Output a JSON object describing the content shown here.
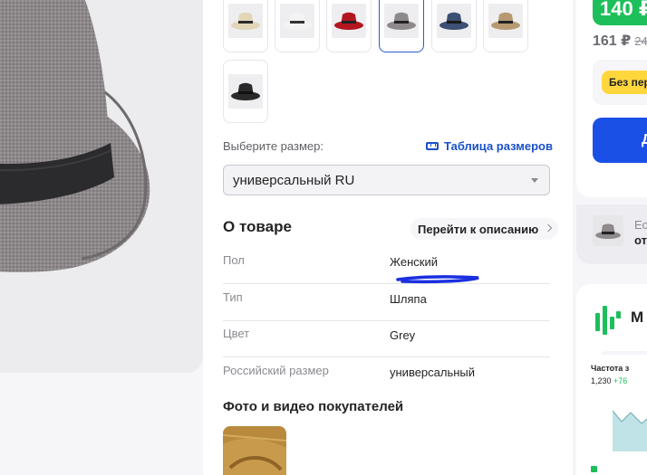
{
  "colors": {
    "accent": "#1a50c9",
    "buy": "#1a50e6",
    "price_badge": "#1dbf5a",
    "tag_yellow": "#fed73d",
    "underline_mark": "#1a2fe0"
  },
  "thumbnails": [
    {
      "name": "beige-fedora-icon",
      "color": "#e3d6b8",
      "band": "#2a2a2a"
    },
    {
      "name": "white-fedora-icon",
      "color": "#f3f3f3",
      "band": "#333333"
    },
    {
      "name": "red-fedora-icon",
      "color": "#b3161f",
      "band": "#222222"
    },
    {
      "name": "grey-fedora-icon",
      "color": "#8e8a8c",
      "band": "#222222",
      "selected": true
    },
    {
      "name": "navy-fedora-icon",
      "color": "#3b5072",
      "band": "#1a1a1a"
    },
    {
      "name": "tan-fedora-icon",
      "color": "#b89a72",
      "band": "#222222"
    },
    {
      "name": "black-fedora-icon",
      "color": "#2a2a2a",
      "band": "#111111"
    }
  ],
  "size": {
    "label": "Выберите размер:",
    "table_link": "Таблица размеров",
    "selected": "универсальный RU"
  },
  "about": {
    "title": "О товаре",
    "goto": "Перейти к описанию",
    "specs": [
      {
        "key": "Пол",
        "value": "Женский"
      },
      {
        "key": "Тип",
        "value": "Шляпа"
      },
      {
        "key": "Цвет",
        "value": "Grey"
      },
      {
        "key": "Российский размер",
        "value": "универсальный"
      }
    ]
  },
  "photos_title": "Фото и видео покупателей",
  "price": {
    "current": "140 ₽",
    "old": "161 ₽",
    "old_strike": "24",
    "tag": "Без пер",
    "buy": "Д"
  },
  "similar": {
    "line1": "Ес",
    "line2": "от"
  },
  "mp": {
    "letter": "M",
    "freq": "Частота з",
    "num": "1,230",
    "num_delta": "+76"
  }
}
